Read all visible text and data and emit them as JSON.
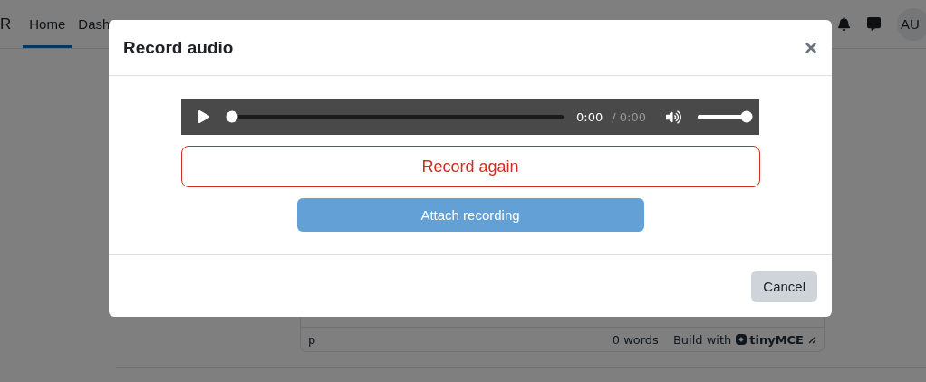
{
  "navbar": {
    "logo_fragment": "R",
    "items": [
      {
        "label": "Home",
        "selected": true
      },
      {
        "label": "Dash",
        "selected": false
      }
    ],
    "avatar": "AU"
  },
  "editor_status": {
    "element_path": "p",
    "word_count": "0 words",
    "branding": "Build with",
    "brand": "tinyMCE"
  },
  "modal": {
    "title": "Record audio",
    "close": "×",
    "player": {
      "progress": {
        "level": 0
      },
      "current_time": "0:00",
      "separator_duration": "/ 0:00",
      "volume": {
        "level": 1
      }
    },
    "record_again": "Record again",
    "attach": "Attach recording",
    "cancel": "Cancel"
  }
}
